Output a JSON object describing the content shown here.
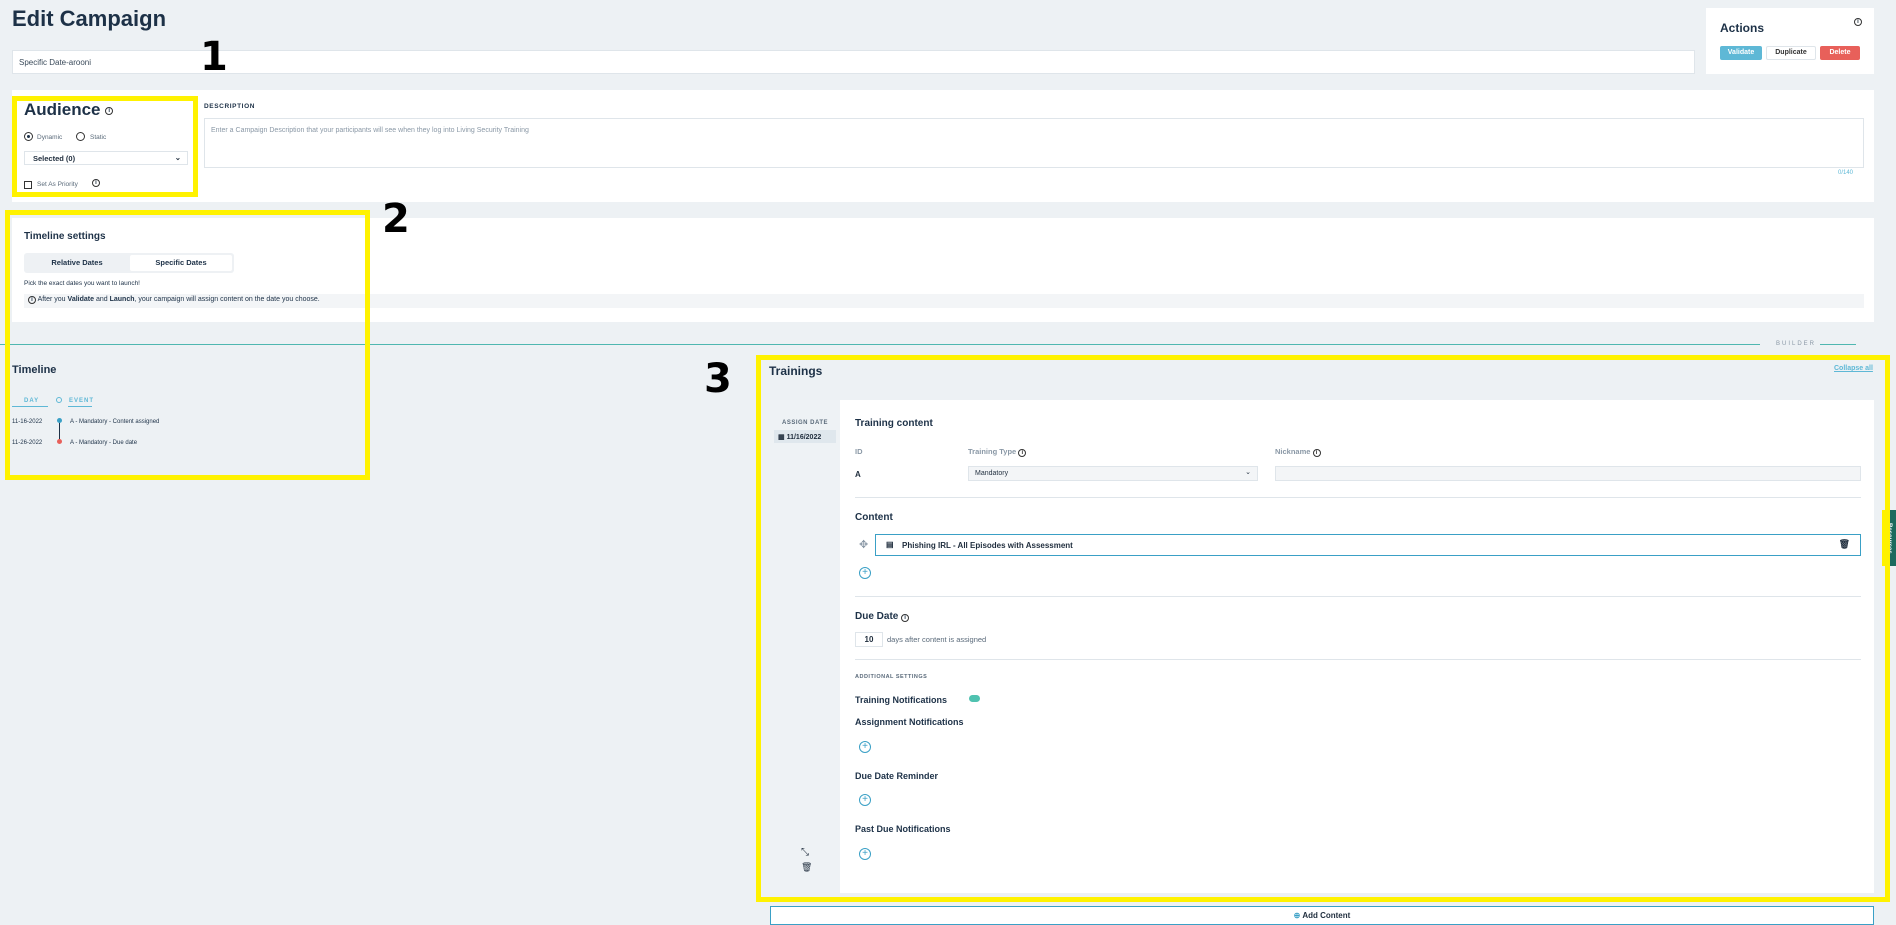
{
  "page": {
    "title": "Edit Campaign",
    "campaign_name": "Specific Date-arooni"
  },
  "actions": {
    "title": "Actions",
    "validate": "Validate",
    "duplicate": "Duplicate",
    "delete": "Delete"
  },
  "audience": {
    "title": "Audience",
    "dynamic": "Dynamic",
    "static": "Static",
    "selected": "Selected (0)",
    "priority": "Set As Priority"
  },
  "description": {
    "label": "DESCRIPTION",
    "placeholder": "Enter a Campaign Description that your participants will see when they log into Living Security Training",
    "count": "0/140"
  },
  "timeline_settings": {
    "title": "Timeline settings",
    "relative": "Relative Dates",
    "specific": "Specific Dates",
    "hint": "Pick the exact dates you want to launch!",
    "info_pre": "After you",
    "validate": "Validate",
    "and": "and",
    "launch": "Launch",
    "info_post": ", your campaign will assign content on the date you choose."
  },
  "builder": {
    "label": "BUILDER"
  },
  "timeline": {
    "title": "Timeline",
    "col_day": "DAY",
    "col_event": "EVENT",
    "rows": [
      {
        "day": "11-16-2022",
        "event": "A - Mandatory - Content assigned",
        "color": "#3aa0c6"
      },
      {
        "day": "11-26-2022",
        "event": "A - Mandatory - Due date",
        "color": "#e8605a"
      }
    ]
  },
  "trainings": {
    "title": "Trainings",
    "collapse_all": "Collapse all",
    "assign_date_label": "ASSIGN DATE",
    "assign_date": "11/16/2022",
    "training_content": "Training content",
    "id_label": "ID",
    "type_label": "Training Type",
    "nickname_label": "Nickname",
    "id_value": "A",
    "type_value": "Mandatory",
    "content_label": "Content",
    "content_value": "Phishing IRL - All Episodes with Assessment",
    "due_date_label": "Due Date",
    "due_days": "10",
    "due_suffix": "days after content is assigned",
    "additional": "ADDITIONAL SETTINGS",
    "notifications": "Training Notifications",
    "assignment_notifications": "Assignment Notifications",
    "due_reminder": "Due Date Reminder",
    "past_due": "Past Due Notifications"
  },
  "add_content": "Add Content",
  "resources": "Resources",
  "annotations": [
    "1",
    "2",
    "3"
  ]
}
